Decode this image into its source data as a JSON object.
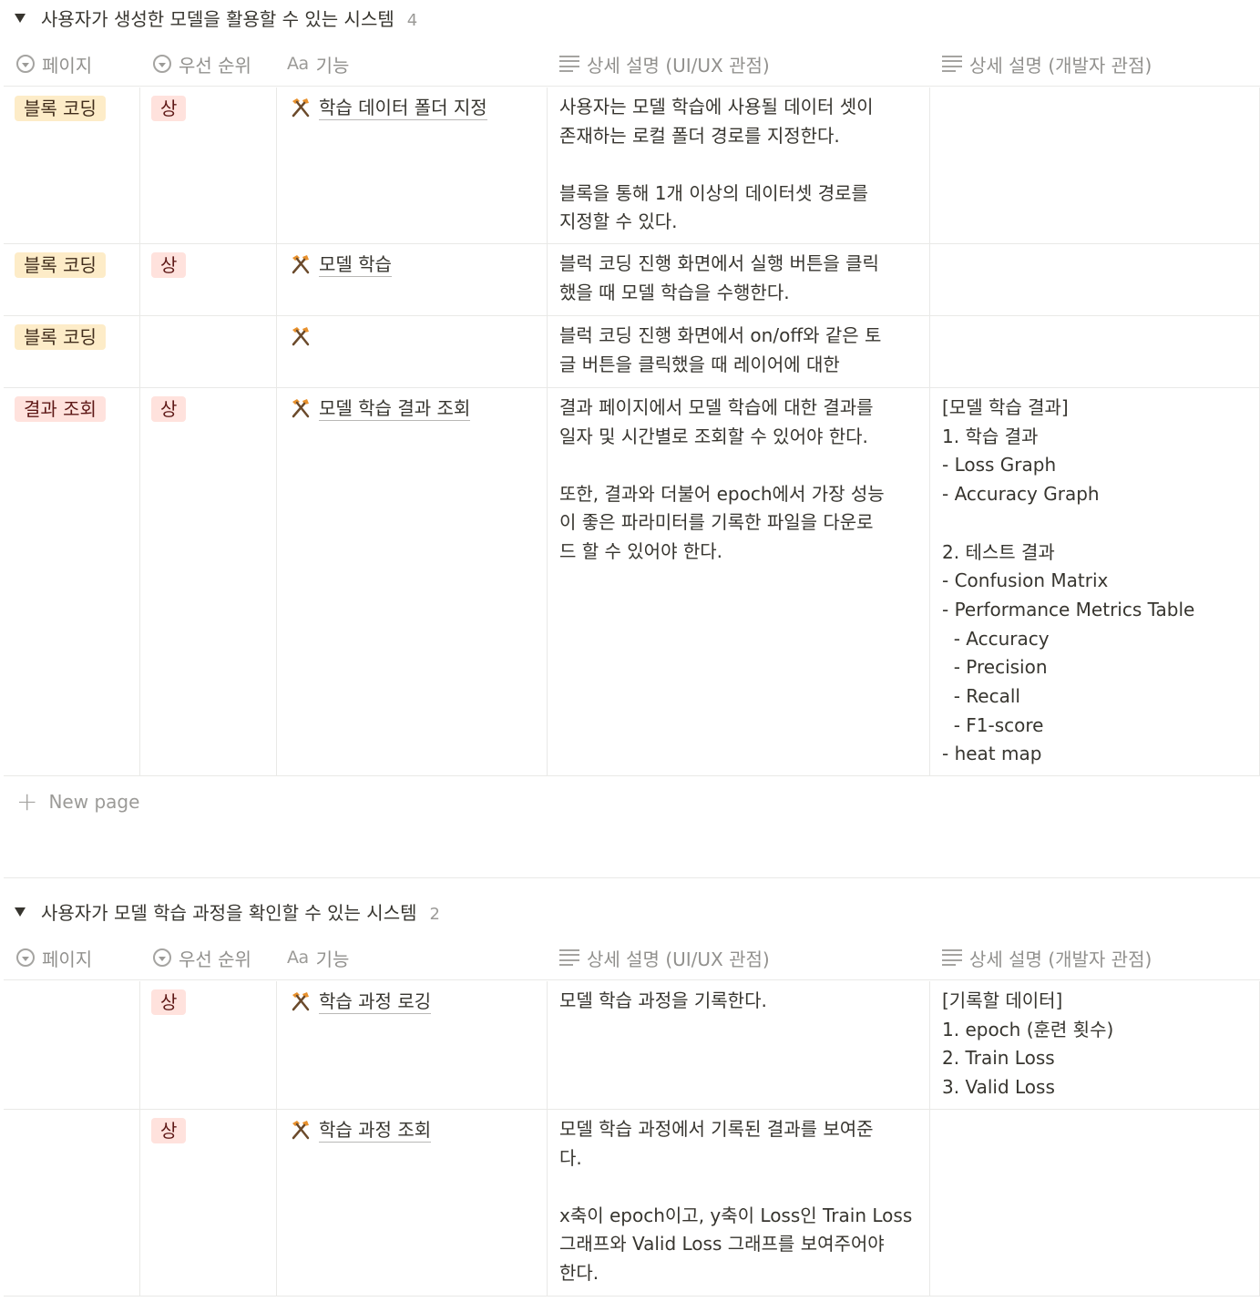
{
  "columns": {
    "page": "페이지",
    "priority": "우선 순위",
    "function": "기능",
    "function_icon_text": "Aa",
    "ux": "상세 설명 (UI/UX 관점)",
    "dev": "상세 설명 (개발자 관점)"
  },
  "groups": [
    {
      "title": "사용자가 생성한 모델을 활용할 수 있는 시스템",
      "count": "4",
      "rows": [
        {
          "page": "블록 코딩",
          "priority": "상",
          "function": "학습 데이터 폴더 지정",
          "ux": "사용자는 모델 학습에 사용될 데이터 셋이\n존재하는 로컬 폴더 경로를 지정한다.\n\n블록을 통해 1개 이상의 데이터셋 경로를\n지정할 수 있다.",
          "dev": ""
        },
        {
          "page": "블록 코딩",
          "priority": "상",
          "function": "모델 학습",
          "ux": "블럭 코딩 진행 화면에서 실행 버튼을 클릭\n했을 때 모델 학습을 수행한다.",
          "dev": ""
        },
        {
          "page": "블록 코딩",
          "priority": "",
          "function": "",
          "ux": "블럭 코딩 진행 화면에서 on/off와 같은 토\n글 버튼을 클릭했을 때 레이어에 대한",
          "dev": ""
        },
        {
          "page": "결과 조회",
          "priority": "상",
          "function": "모델 학습 결과 조회",
          "ux": "결과 페이지에서 모델 학습에 대한 결과를\n일자 및 시간별로 조회할 수 있어야 한다.\n\n또한, 결과와 더불어 epoch에서 가장 성능\n이 좋은 파라미터를 기록한 파일을 다운로\n드 할 수 있어야 한다.",
          "dev": "[모델 학습 결과]\n1. 학습 결과\n- Loss Graph\n- Accuracy Graph\n\n2. 테스트 결과\n- Confusion Matrix\n- Performance Metrics Table\n  - Accuracy\n  - Precision\n  - Recall\n  - F1-score\n- heat map"
        }
      ],
      "new_page": "New page"
    },
    {
      "title": "사용자가 모델 학습 과정을 확인할 수 있는 시스템",
      "count": "2",
      "rows": [
        {
          "page": "",
          "priority": "상",
          "function": "학습 과정 로깅",
          "ux": "모델 학습 과정을 기록한다.",
          "dev": "[기록할 데이터]\n1. epoch (훈련 횟수)\n2. Train Loss\n3. Valid Loss"
        },
        {
          "page": "",
          "priority": "상",
          "function": "학습 과정 조회",
          "ux": "모델 학습 과정에서 기록된 결과를 보여준\n다.\n\nx축이 epoch이고, y축이 Loss인 Train Loss\n그래프와 Valid Loss 그래프를 보여주어야\n한다.",
          "dev": ""
        }
      ]
    }
  ],
  "colors": {
    "tag_block_bg": "#fdecc8",
    "tag_red_bg": "#ffe2dd",
    "hammer": "#e8912d"
  }
}
